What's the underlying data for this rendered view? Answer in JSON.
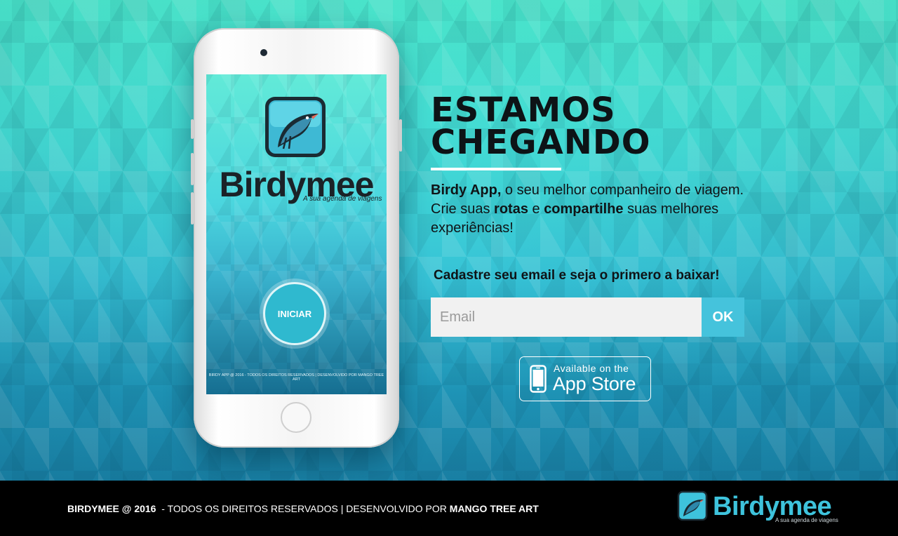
{
  "colors": {
    "accent": "#45c3dc",
    "headline": "#0d1316",
    "footer_bg": "#000000",
    "brand_footer": "#3ec3dc"
  },
  "phone_mockup": {
    "brand": "Birdymee",
    "tagline": "A sua agenda de viagens",
    "start_button": "INICIAR",
    "credit": "BIRDY APP @ 2016 - TODOS OS DIREITOS RESERVADOS | DESENVOLVIDO POR MANGO TREE ART",
    "icon": "bird-app-icon"
  },
  "hero": {
    "headline_line1": "ESTAMOS",
    "headline_line2": "CHEGANDO",
    "intro": {
      "part1": "Birdy App,",
      "part2": " o seu melhor companheiro de viagem. Crie suas ",
      "part3": "rotas",
      "part4": " e ",
      "part5": "compartilhe",
      "part6": " suas melhores experiências!"
    },
    "cta": "Cadastre seu email e seja o primero a baixar!"
  },
  "signup": {
    "email_placeholder": "Email",
    "email_value": "",
    "submit_label": "OK"
  },
  "appstore_badge": {
    "line1": "Available on the",
    "line2": "App Store",
    "icon": "iphone-icon"
  },
  "footer": {
    "brand_bold": "BIRDYMEE @ 2016",
    "middle": "  - TODOS OS DIREITOS RESERVADOS | DESENVOLVIDO POR ",
    "author": "MANGO TREE ART",
    "logo_brand": "Birdymee",
    "logo_tagline": "A sua agenda de viagens",
    "logo_icon": "bird-logo-icon"
  }
}
